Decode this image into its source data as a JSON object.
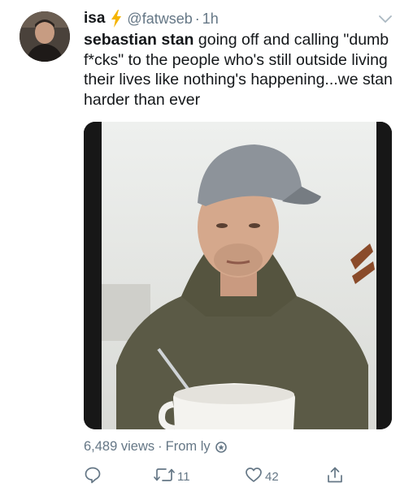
{
  "tweet": {
    "author": {
      "display_name": "isa",
      "handle": "@fatwseb",
      "separator": "·",
      "time": "1h"
    },
    "text": {
      "bold_part": "sebastian stan",
      "rest": " going off and calling \"dumb f*cks\" to the people who's still outside living their lives like nothing's happening...we stan harder than ever"
    },
    "meta": {
      "views": "6,489 views",
      "separator": "·",
      "from": "From ly"
    },
    "actions": {
      "reply_count": "",
      "retweet_count": "11",
      "like_count": "42"
    }
  },
  "icons": {
    "bolt": "lightning-bolt-icon",
    "caret": "chevron-down-icon",
    "reply": "reply-icon",
    "retweet": "retweet-icon",
    "like": "heart-icon",
    "share": "share-icon",
    "badge": "circle-badge-icon"
  },
  "colors": {
    "text_primary": "#14171a",
    "text_secondary": "#657786",
    "bolt": "#f5b400"
  }
}
